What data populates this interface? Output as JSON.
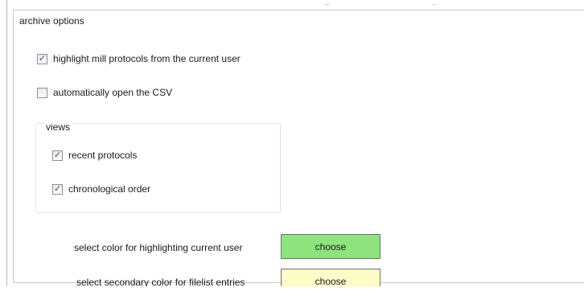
{
  "archive_options": {
    "title": "archive options",
    "highlight_mill": {
      "label": "highlight mill protocols from the current user",
      "checked": true
    },
    "auto_open_csv": {
      "label": "automatically open the CSV",
      "checked": false
    },
    "views": {
      "title": "views",
      "recent_protocols": {
        "label": "recent protocols",
        "checked": true
      },
      "chronological_order": {
        "label": "chronological order",
        "checked": true
      }
    },
    "highlight_color": {
      "label": "select color for highlighting current user",
      "button_label": "choose",
      "color": "#8ee37f"
    },
    "secondary_color": {
      "label": "select secondary color for filelist entries",
      "button_label": "choose",
      "color": "#fdfbc6"
    }
  },
  "colors": {
    "checkmark": "#2a4fb0",
    "border": "#c9c9c9"
  }
}
